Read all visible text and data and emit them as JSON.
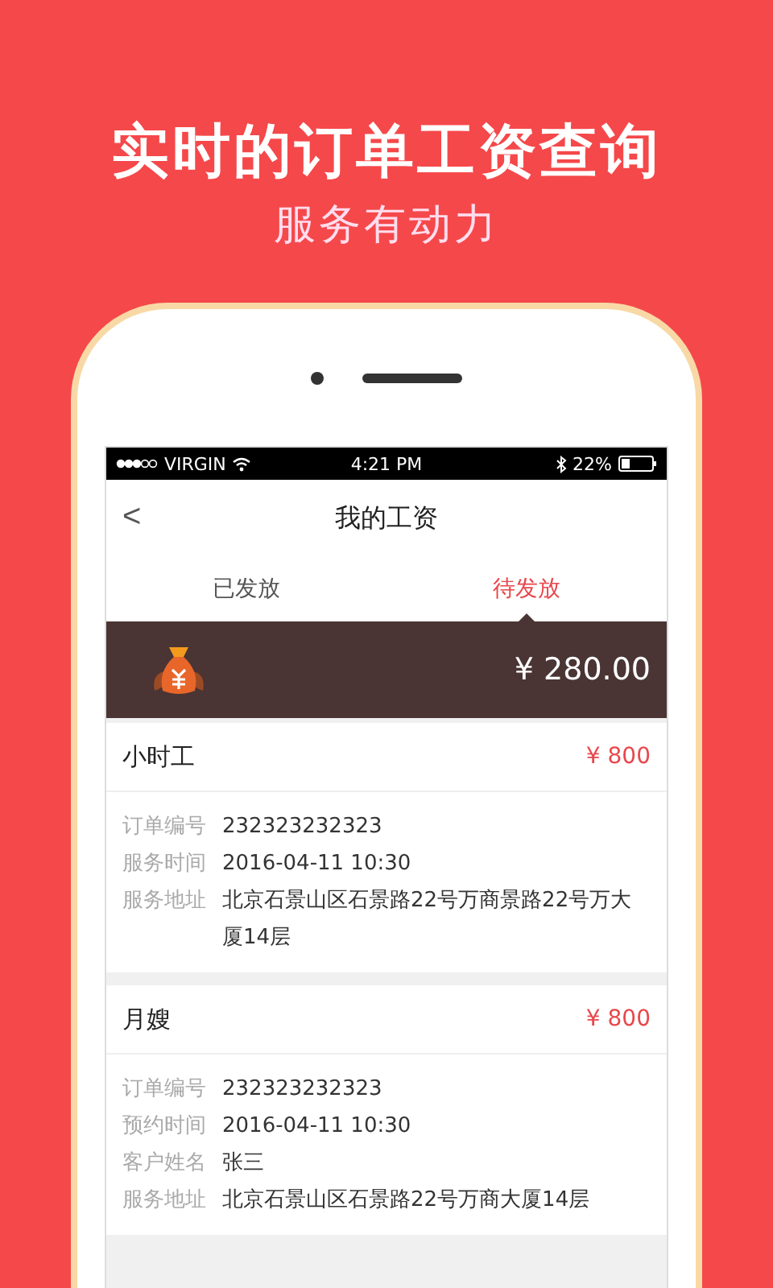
{
  "headline": "实时的订单工资查询",
  "subheadline": "服务有动力",
  "status_bar": {
    "carrier": "VIRGIN",
    "time": "4:21 PM",
    "battery": "22%"
  },
  "nav": {
    "back": "<",
    "title": "我的工资"
  },
  "tabs": [
    {
      "label": "已发放",
      "selected": false
    },
    {
      "label": "待发放",
      "selected": true
    }
  ],
  "balance": {
    "amount": "¥ 280.00"
  },
  "orders": [
    {
      "title": "小时工",
      "price": "¥ 800",
      "fields": [
        {
          "label": "订单编号",
          "value": "232323232323"
        },
        {
          "label": "服务时间",
          "value": "2016-04-11 10:30"
        },
        {
          "label": "服务地址",
          "value": "北京石景山区石景路22号万商景路22号万大厦14层"
        }
      ]
    },
    {
      "title": "月嫂",
      "price": "¥ 800",
      "fields": [
        {
          "label": "订单编号",
          "value": "232323232323"
        },
        {
          "label": "预约时间",
          "value": "2016-04-11 10:30"
        },
        {
          "label": "客户姓名",
          "value": "张三"
        },
        {
          "label": "服务地址",
          "value": "北京石景山区石景路22号万商大厦14层"
        }
      ]
    }
  ]
}
